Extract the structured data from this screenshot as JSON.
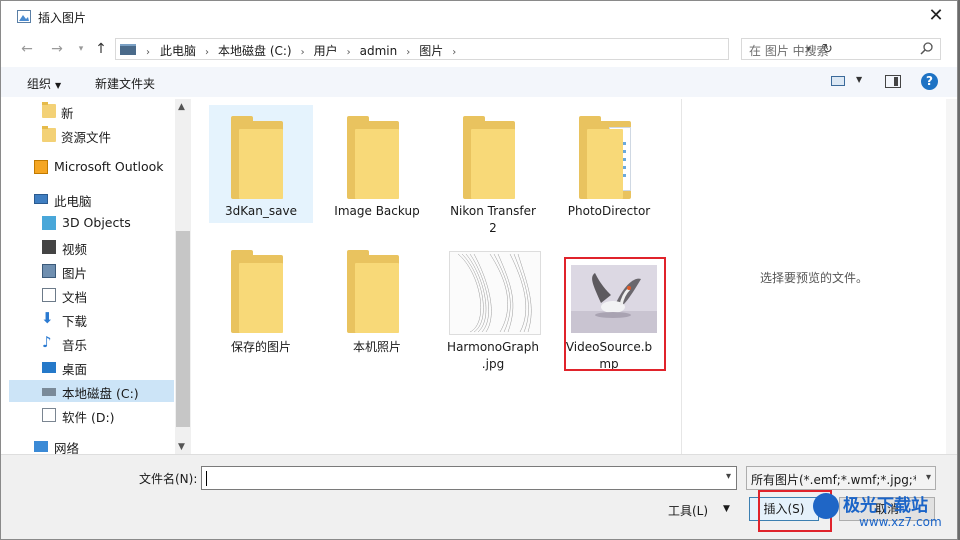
{
  "window": {
    "title": "插入图片",
    "close": "✕"
  },
  "nav": {
    "back": "←",
    "forward": "→",
    "up": "↑",
    "refresh": "↻"
  },
  "address": {
    "crumbs": [
      "此电脑",
      "本地磁盘 (C:)",
      "用户",
      "admin",
      "图片"
    ],
    "sep": "›"
  },
  "search": {
    "placeholder": "在 图片 中搜索"
  },
  "toolbar": {
    "organize": "组织",
    "new_folder": "新建文件夹",
    "help": "?"
  },
  "sidebar": {
    "items": [
      {
        "label": "新",
        "icon": "folder-icon"
      },
      {
        "label": "资源文件",
        "icon": "folder-icon"
      },
      {
        "label": "Microsoft Outlook",
        "icon": "outlook-icon"
      },
      {
        "label": "此电脑",
        "icon": "computer-icon"
      },
      {
        "label": "3D Objects",
        "icon": "3d-objects-icon"
      },
      {
        "label": "视频",
        "icon": "video-icon"
      },
      {
        "label": "图片",
        "icon": "pictures-icon"
      },
      {
        "label": "文档",
        "icon": "documents-icon"
      },
      {
        "label": "下载",
        "icon": "download-icon"
      },
      {
        "label": "音乐",
        "icon": "music-icon"
      },
      {
        "label": "桌面",
        "icon": "desktop-icon"
      },
      {
        "label": "本地磁盘 (C:)",
        "icon": "disk-icon",
        "selected": true
      },
      {
        "label": "软件 (D:)",
        "icon": "drive-icon"
      },
      {
        "label": "网络",
        "icon": "network-icon"
      }
    ]
  },
  "files": [
    {
      "name": "3dKan_save",
      "type": "folder",
      "selected": true
    },
    {
      "name": "Image Backup",
      "type": "folder"
    },
    {
      "name": "Nikon Transfer 2",
      "type": "folder"
    },
    {
      "name": "PhotoDirector",
      "type": "folder"
    },
    {
      "name": "保存的图片",
      "type": "folder"
    },
    {
      "name": "本机照片",
      "type": "folder"
    },
    {
      "name": "HarmonoGraph.jpg",
      "type": "image"
    },
    {
      "name": "VideoSource.bmp",
      "type": "image",
      "highlighted": true
    }
  ],
  "file_labels": {
    "f0": "3dKan_save",
    "f1": "Image Backup",
    "f2a": "Nikon Transfer",
    "f2b": "2",
    "f3": "PhotoDirector",
    "f4": "保存的图片",
    "f5": "本机照片",
    "f6a": "HarmonoGraph",
    "f6b": ".jpg",
    "f7a": "VideoSource.b",
    "f7b": "mp"
  },
  "preview": {
    "text": "选择要预览的文件。"
  },
  "bottom": {
    "filename_label": "文件名(N):",
    "filename_value": "",
    "filter": "所有图片(*.emf;*.wmf;*.jpg;*.jp",
    "tools": "工具(L)",
    "insert": "插入(S)",
    "cancel": "取消"
  },
  "watermark": {
    "text": "极光下载站",
    "url": "www.xz7.com"
  },
  "colors": {
    "accent": "#1e73c4",
    "highlight": "#e0232b",
    "selection": "#cce4f7"
  }
}
